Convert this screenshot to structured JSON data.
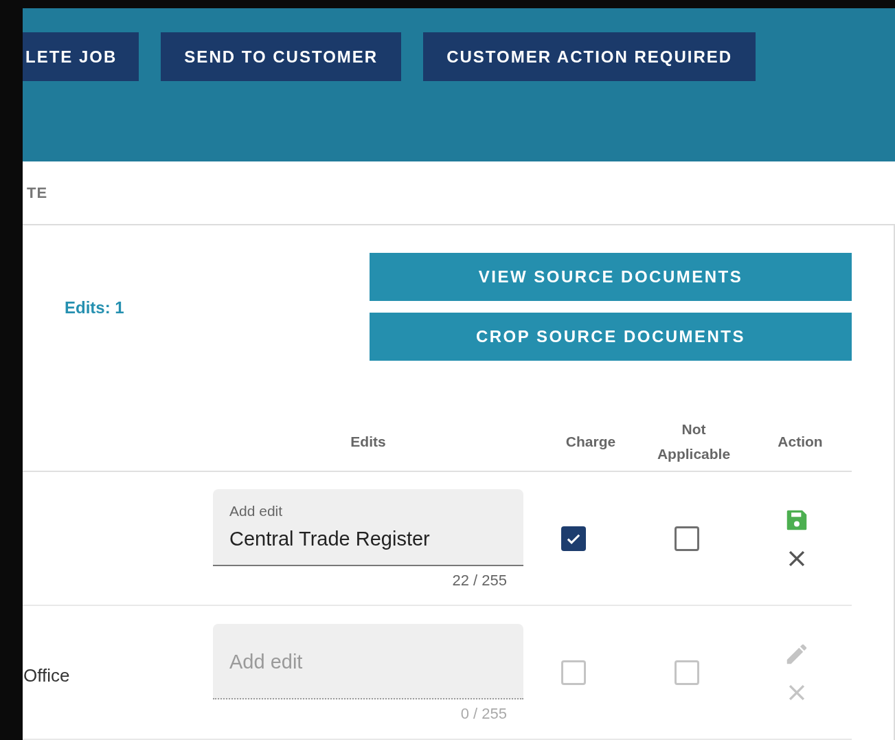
{
  "header_buttons": [
    "LETE JOB",
    "SEND TO CUSTOMER",
    "CUSTOMER ACTION REQUIRED"
  ],
  "tab": {
    "label": "TE"
  },
  "edits_count": "Edits: 1",
  "document_buttons": [
    "VIEW SOURCE DOCUMENTS",
    "CROP SOURCE DOCUMENTS"
  ],
  "table": {
    "columns": [
      "Edits",
      "Charge",
      "Not Applicable",
      "Action"
    ],
    "rows": [
      {
        "kind": "save",
        "field": {
          "label": "Add edit",
          "value": "Central Trade Register",
          "counter": "22 / 255"
        },
        "charge": true,
        "not_applicable": false,
        "disabled": false
      },
      {
        "kind": "edit",
        "name": "Office",
        "field": {
          "placeholder": "Add edit",
          "counter": "0 / 255"
        },
        "charge": false,
        "not_applicable": false,
        "disabled": true
      }
    ]
  }
}
